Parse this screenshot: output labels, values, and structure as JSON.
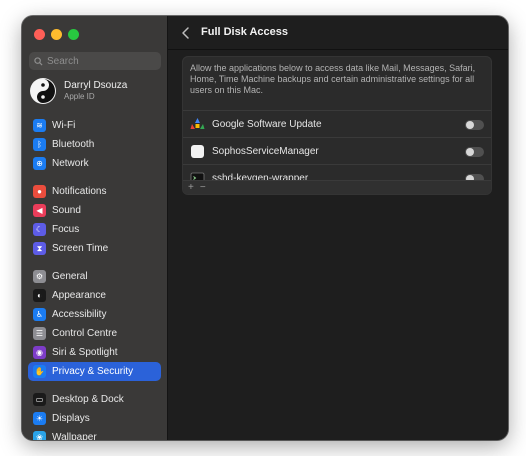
{
  "window": {
    "title": "Full Disk Access"
  },
  "sidebar": {
    "search_placeholder": "Search",
    "account": {
      "name": "Darryl Dsouza",
      "subtitle": "Apple ID"
    },
    "items": [
      {
        "label": "Wi-Fi",
        "icon": "wifi-icon",
        "color": "#1b7cf2",
        "glyph": "≋"
      },
      {
        "label": "Bluetooth",
        "icon": "bluetooth-icon",
        "color": "#1b7cf2",
        "glyph": "ᛒ"
      },
      {
        "label": "Network",
        "icon": "network-icon",
        "color": "#1b7cf2",
        "glyph": "⊕"
      },
      {
        "label": "Notifications",
        "icon": "bell-icon",
        "color": "#eb4d3d",
        "glyph": "●"
      },
      {
        "label": "Sound",
        "icon": "speaker-icon",
        "color": "#eb3d5a",
        "glyph": "◀"
      },
      {
        "label": "Focus",
        "icon": "moon-icon",
        "color": "#5d5ce6",
        "glyph": "☾"
      },
      {
        "label": "Screen Time",
        "icon": "hourglass-icon",
        "color": "#5d5ce6",
        "glyph": "⧗"
      },
      {
        "label": "General",
        "icon": "gear-icon",
        "color": "#8e8e93",
        "glyph": "⚙"
      },
      {
        "label": "Appearance",
        "icon": "appearance-icon",
        "color": "#1a1a1a",
        "glyph": "◐"
      },
      {
        "label": "Accessibility",
        "icon": "accessibility-icon",
        "color": "#1b7cf2",
        "glyph": "♿"
      },
      {
        "label": "Control Centre",
        "icon": "control-centre-icon",
        "color": "#8e8e93",
        "glyph": "☰"
      },
      {
        "label": "Siri & Spotlight",
        "icon": "siri-icon",
        "color": "#7d3cc8",
        "glyph": "◉"
      },
      {
        "label": "Privacy & Security",
        "icon": "hand-icon",
        "color": "#1b7cf2",
        "glyph": "✋",
        "active": true
      },
      {
        "label": "Desktop & Dock",
        "icon": "dock-icon",
        "color": "#1a1a1a",
        "glyph": "▭"
      },
      {
        "label": "Displays",
        "icon": "sun-icon",
        "color": "#1b7cf2",
        "glyph": "☀"
      },
      {
        "label": "Wallpaper",
        "icon": "wallpaper-icon",
        "color": "#2aa3e8",
        "glyph": "❀"
      }
    ]
  },
  "main": {
    "description": "Allow the applications below to access data like Mail, Messages, Safari, Home, Time Machine backups and certain administrative settings for all users on this Mac.",
    "apps": [
      {
        "name": "Google Software Update",
        "icon": "google-software-update-icon",
        "enabled": false
      },
      {
        "name": "SophosServiceManager",
        "icon": "sophos-icon",
        "enabled": false
      },
      {
        "name": "sshd-keygen-wrapper",
        "icon": "terminal-icon",
        "enabled": false
      }
    ],
    "add_label": "+",
    "remove_label": "−"
  }
}
